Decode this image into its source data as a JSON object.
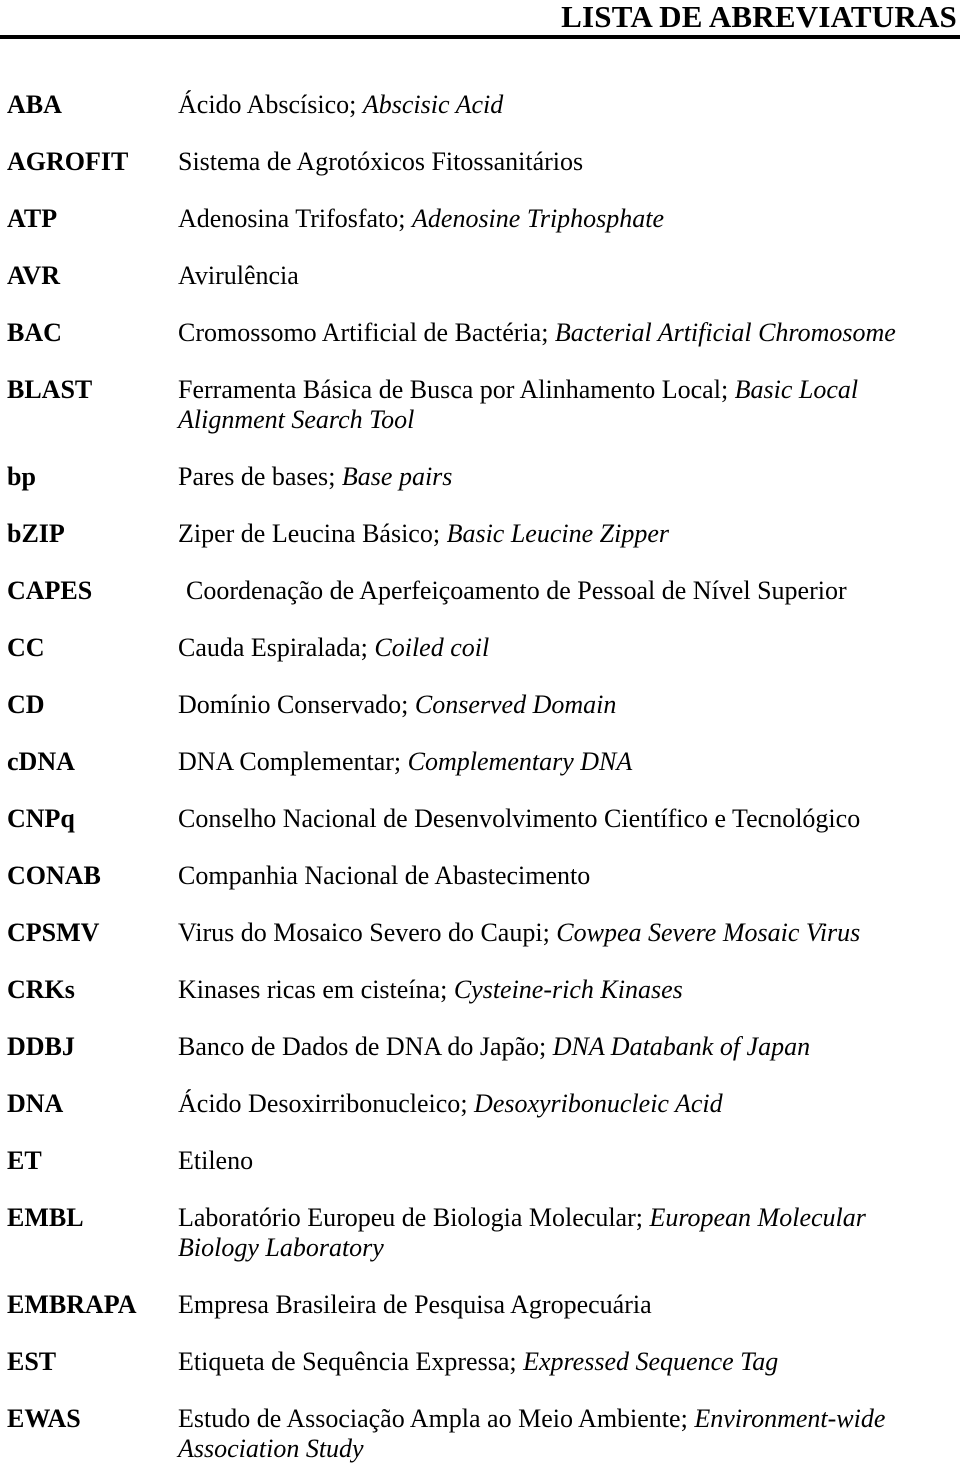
{
  "document": {
    "title": "LISTA DE ABREVIATURAS",
    "language": "pt-BR"
  },
  "entries": [
    {
      "term": "ABA",
      "pt": "Ácido Abscísico",
      "sep": "; ",
      "en": "Abscisic Acid",
      "full": "Ácido Abscísico; Abscisic Acid"
    },
    {
      "term": "AGROFIT",
      "pt": "Sistema de Agrotóxicos Fitossanitários",
      "sep": "",
      "en": "",
      "full": "Sistema de Agrotóxicos Fitossanitários"
    },
    {
      "term": "ATP",
      "pt": "Adenosina Trifosfato",
      "sep": "; ",
      "en": "Adenosine Triphosphate",
      "full": "Adenosina Trifosfato; Adenosine Triphosphate"
    },
    {
      "term": "AVR",
      "pt": "Avirulência",
      "sep": "",
      "en": "",
      "full": "Avirulência"
    },
    {
      "term": "BAC",
      "pt": "Cromossomo Artificial de Bactéria",
      "sep": "; ",
      "en": "Bacterial Artificial Chromosome",
      "full": "Cromossomo Artificial de Bactéria; Bacterial Artificial Chromosome"
    },
    {
      "term": "BLAST",
      "pt": "Ferramenta Básica de Busca por Alinhamento Local",
      "sep": "; ",
      "en": "Basic Local Alignment Search Tool",
      "full": "Ferramenta Básica de Busca por Alinhamento Local; Basic Local Alignment Search Tool"
    },
    {
      "term": "bp",
      "pt": "Pares de bases",
      "sep": "; ",
      "en": "Base pairs",
      "full": "Pares de bases; Base pairs"
    },
    {
      "term": "bZIP",
      "pt": "Ziper de Leucina Básico",
      "sep": "; ",
      "en": "Basic Leucine Zipper",
      "full": "Ziper de Leucina Básico; Basic Leucine Zipper"
    },
    {
      "term": "CAPES",
      "pt": "Coordenação de Aperfeiçoamento de Pessoal de Nível Superior",
      "sep": "",
      "en": "",
      "full": "Coordenação de Aperfeiçoamento de Pessoal de Nível Superior"
    },
    {
      "term": "CC",
      "pt": "Cauda Espiralada",
      "sep": "; ",
      "en": "Coiled coil",
      "full": "Cauda Espiralada; Coiled coil"
    },
    {
      "term": "CD",
      "pt": "Domínio Conservado",
      "sep": "; ",
      "en": "Conserved Domain",
      "full": "Domínio Conservado; Conserved Domain"
    },
    {
      "term": "cDNA",
      "pt": "DNA Complementar",
      "sep": "; ",
      "en": "Complementary DNA",
      "full": "DNA Complementar; Complementary DNA"
    },
    {
      "term": "CNPq",
      "pt": "Conselho Nacional de Desenvolvimento Científico e Tecnológico",
      "sep": "",
      "en": "",
      "full": "Conselho Nacional de Desenvolvimento Científico e Tecnológico"
    },
    {
      "term": "CONAB",
      "pt": "Companhia Nacional de Abastecimento",
      "sep": "",
      "en": "",
      "full": "Companhia Nacional de Abastecimento"
    },
    {
      "term": "CPSMV",
      "pt": "Virus do Mosaico Severo do Caupi",
      "sep": "; ",
      "en": "Cowpea Severe Mosaic Virus",
      "full": "Virus do Mosaico Severo do Caupi; Cowpea Severe Mosaic Virus"
    },
    {
      "term": "CRKs",
      "pt": "Kinases ricas em cisteína",
      "sep": "; ",
      "en": "Cysteine-rich Kinases",
      "full": "Kinases ricas em cisteína; Cysteine-rich Kinases"
    },
    {
      "term": "DDBJ",
      "pt": "Banco de Dados de DNA do Japão",
      "sep": "; ",
      "en": "DNA Databank of Japan",
      "full": "Banco de Dados de DNA do Japão; DNA Databank of Japan"
    },
    {
      "term": "DNA",
      "pt": "Ácido Desoxirribonucleico",
      "sep": "; ",
      "en": "Desoxyribonucleic Acid",
      "full": "Ácido Desoxirribonucleico; Desoxyribonucleic Acid"
    },
    {
      "term": "ET",
      "pt": "Etileno",
      "sep": "",
      "en": "",
      "full": "Etileno"
    },
    {
      "term": "EMBL",
      "pt": "Laboratório Europeu de Biologia Molecular",
      "sep": "; ",
      "en": "European Molecular Biology Laboratory",
      "full": "Laboratório Europeu de Biologia Molecular; European Molecular Biology Laboratory"
    },
    {
      "term": "EMBRAPA",
      "pt": "Empresa Brasileira de Pesquisa Agropecuária",
      "sep": "",
      "en": "",
      "full": "Empresa Brasileira de Pesquisa Agropecuária"
    },
    {
      "term": "EST",
      "pt": "Etiqueta de Sequência Expressa",
      "sep": "; ",
      "en": "Expressed Sequence Tag",
      "full": "Etiqueta de Sequência Expressa; Expressed Sequence Tag"
    },
    {
      "term": "EWAS",
      "pt": "Estudo de Associação Ampla ao Meio Ambiente",
      "sep": "; ",
      "en": "Environment-wide Association Study",
      "full": "Estudo de Associação Ampla ao Meio Ambiente; Environment-wide Association Study"
    }
  ]
}
